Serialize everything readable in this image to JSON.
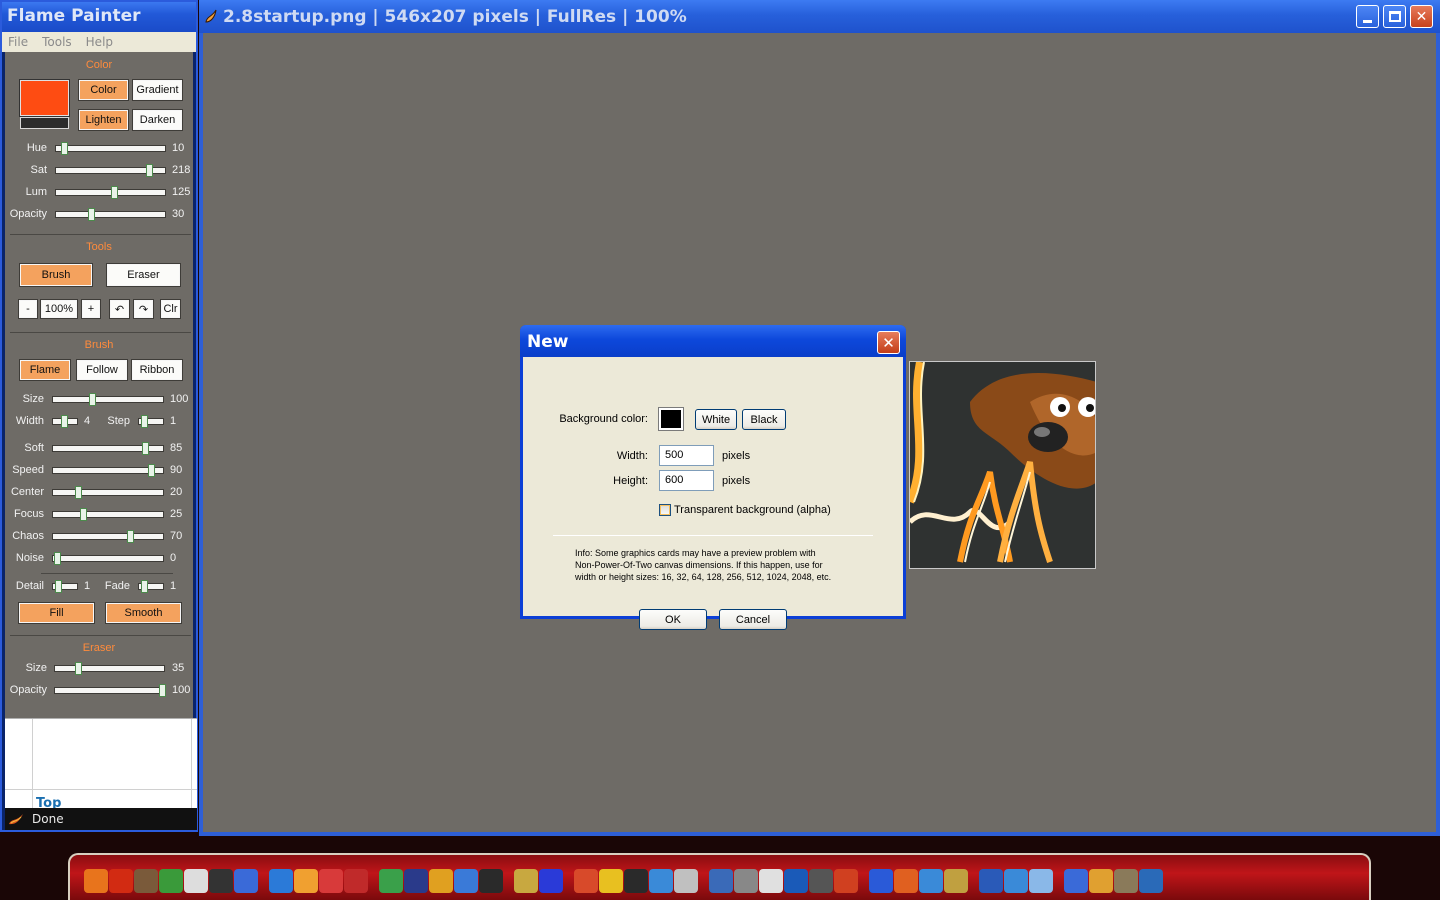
{
  "flame_painter": {
    "title": "Flame Painter",
    "menu": [
      "File",
      "Tools",
      "Help"
    ],
    "color_section": {
      "title": "Color",
      "swatch_primary": "#fe4c12",
      "swatch_secondary": "#2c2c2c",
      "buttons": {
        "color": "Color",
        "gradient": "Gradient",
        "lighten": "Lighten",
        "darken": "Darken"
      },
      "sliders": [
        {
          "label": "Hue",
          "value": "10",
          "level": 0.04
        },
        {
          "label": "Sat",
          "value": "218",
          "level": 0.86
        },
        {
          "label": "Lum",
          "value": "125",
          "level": 0.52
        },
        {
          "label": "Opacity",
          "value": "30",
          "level": 0.3
        }
      ]
    },
    "tools_section": {
      "title": "Tools",
      "brush": "Brush",
      "eraser": "Eraser",
      "minus": "-",
      "zoom": "100%",
      "plus": "+",
      "clear": "Clr"
    },
    "brush_section": {
      "title": "Brush",
      "modes": {
        "flame": "Flame",
        "follow": "Follow",
        "ribbon": "Ribbon"
      },
      "size": {
        "label": "Size",
        "value": "100",
        "level": 0.34
      },
      "width": {
        "label": "Width",
        "value": "4",
        "level": 0.4
      },
      "step": {
        "label": "Step",
        "value": "1",
        "level": 0.05
      },
      "sliders": [
        {
          "label": "Soft",
          "value": "85",
          "level": 0.85
        },
        {
          "label": "Speed",
          "value": "90",
          "level": 0.9
        },
        {
          "label": "Center",
          "value": "20",
          "level": 0.2
        },
        {
          "label": "Focus",
          "value": "25",
          "level": 0.25
        },
        {
          "label": "Chaos",
          "value": "70",
          "level": 0.7
        },
        {
          "label": "Noise",
          "value": "0",
          "level": 0.0
        }
      ],
      "detail": {
        "label": "Detail",
        "value": "1",
        "level": 0.05
      },
      "fade": {
        "label": "Fade",
        "value": "1",
        "level": 0.05
      },
      "fill": "Fill",
      "smooth": "Smooth"
    },
    "eraser_section": {
      "title": "Eraser",
      "sliders": [
        {
          "label": "Size",
          "value": "35",
          "level": 0.18
        },
        {
          "label": "Opacity",
          "value": "100",
          "level": 1.0
        }
      ]
    },
    "help_toc": "Top",
    "status": "Done"
  },
  "image_window": {
    "title": "2.8startup.png | 546x207 pixels | FullRes | 100%"
  },
  "new_dialog": {
    "title": "New",
    "bg_label": "Background color:",
    "bg_swatch": "#000000",
    "white": "White",
    "black": "Black",
    "width_label": "Width:",
    "width_value": "500",
    "height_label": "Height:",
    "height_value": "600",
    "unit": "pixels",
    "transparent": "Transparent background (alpha)",
    "info_lines": [
      "Info: Some graphics cards may have a preview problem with",
      "Non-Power-Of-Two canvas dimensions. If this happen, use for",
      "width or height sizes: 16, 32, 64, 128, 256, 512, 1024, 2048, etc."
    ],
    "ok": "OK",
    "cancel": "Cancel"
  },
  "dock": {
    "icons": [
      {
        "name": "firefox-icon",
        "color": "#e8741c"
      },
      {
        "name": "flame-icon",
        "color": "#d22b12"
      },
      {
        "name": "gimp-icon",
        "color": "#7a5a3a"
      },
      {
        "name": "chrome-icon",
        "color": "#3a9a3a"
      },
      {
        "name": "keyboard-icon",
        "color": "#dddddd"
      },
      {
        "name": "terminal-icon",
        "color": "#333333"
      },
      {
        "name": "usb-icon",
        "color": "#3a6ad8"
      },
      {
        "name": "ie-icon",
        "color": "#2b7ad8"
      },
      {
        "name": "book-icon",
        "color": "#f0a030"
      },
      {
        "name": "pdf-icon",
        "color": "#d83a3a"
      },
      {
        "name": "pdf2-icon",
        "color": "#c02a2a"
      },
      {
        "name": "paint-icon",
        "color": "#3aa04a"
      },
      {
        "name": "movie-icon",
        "color": "#2a3a8a"
      },
      {
        "name": "apps-icon",
        "color": "#e0a020"
      },
      {
        "name": "globe-icon",
        "color": "#3a7ad8"
      },
      {
        "name": "text-icon",
        "color": "#2a2a2a"
      },
      {
        "name": "edit-icon",
        "color": "#c8a840"
      },
      {
        "name": "font-icon",
        "color": "#2a3ad8"
      },
      {
        "name": "magic-icon",
        "color": "#d84a2a"
      },
      {
        "name": "bolt-icon",
        "color": "#e8c020"
      },
      {
        "name": "inkscape-icon",
        "color": "#2a2a2a"
      },
      {
        "name": "check-icon",
        "color": "#3a8ad8"
      },
      {
        "name": "calc-icon",
        "color": "#c0c0c0"
      },
      {
        "name": "search-icon",
        "color": "#3a6ab8"
      },
      {
        "name": "link-icon",
        "color": "#888888"
      },
      {
        "name": "mail-icon",
        "color": "#e0e0e0"
      },
      {
        "name": "photoshop-icon",
        "color": "#1a5ab8"
      },
      {
        "name": "eye-icon",
        "color": "#555555"
      },
      {
        "name": "flamepainter-icon",
        "color": "#d04020"
      },
      {
        "name": "sphere-icon",
        "color": "#2a5ad8"
      },
      {
        "name": "fire-icon",
        "color": "#e06020"
      },
      {
        "name": "3d-icon",
        "color": "#3a8ad8"
      },
      {
        "name": "beer-icon",
        "color": "#c0a040"
      },
      {
        "name": "word-icon",
        "color": "#2a5ab8"
      },
      {
        "name": "clock-icon",
        "color": "#3a8ad8"
      },
      {
        "name": "cloud-icon",
        "color": "#8ab8e8"
      },
      {
        "name": "wave-icon",
        "color": "#3a6ad8"
      },
      {
        "name": "rings-icon",
        "color": "#e0a030"
      },
      {
        "name": "box-icon",
        "color": "#8a7a5a"
      },
      {
        "name": "disc-icon",
        "color": "#2a6ab8"
      }
    ]
  }
}
